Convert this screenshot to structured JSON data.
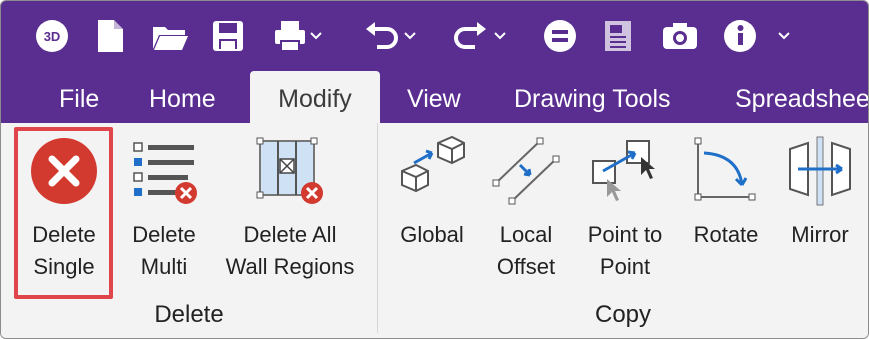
{
  "qat": {
    "icons": [
      "3d-icon",
      "new-file-icon",
      "open-folder-icon",
      "save-icon",
      "print-icon",
      "undo-icon",
      "redo-icon",
      "equals-icon",
      "report-icon",
      "camera-icon",
      "info-icon"
    ]
  },
  "tabs": [
    "File",
    "Home",
    "Modify",
    "View",
    "Drawing Tools",
    "Spreadsheet"
  ],
  "active_tab": "Modify",
  "ribbon": {
    "delete_group": {
      "label": "Delete",
      "buttons": [
        {
          "line1": "Delete",
          "line2": "Single"
        },
        {
          "line1": "Delete",
          "line2": "Multi"
        },
        {
          "line1": "Delete All",
          "line2": "Wall Regions"
        }
      ]
    },
    "copy_group": {
      "label": "Copy",
      "buttons": [
        {
          "line1": "Global",
          "line2": ""
        },
        {
          "line1": "Local",
          "line2": "Offset"
        },
        {
          "line1": "Point to",
          "line2": "Point"
        },
        {
          "line1": "Rotate",
          "line2": ""
        },
        {
          "line1": "Mirror",
          "line2": ""
        }
      ]
    }
  },
  "colors": {
    "titlebar": "#5a2d91",
    "delete_red": "#d33a2f",
    "highlight": "#e0454b",
    "accent_blue": "#1f6fc9"
  }
}
